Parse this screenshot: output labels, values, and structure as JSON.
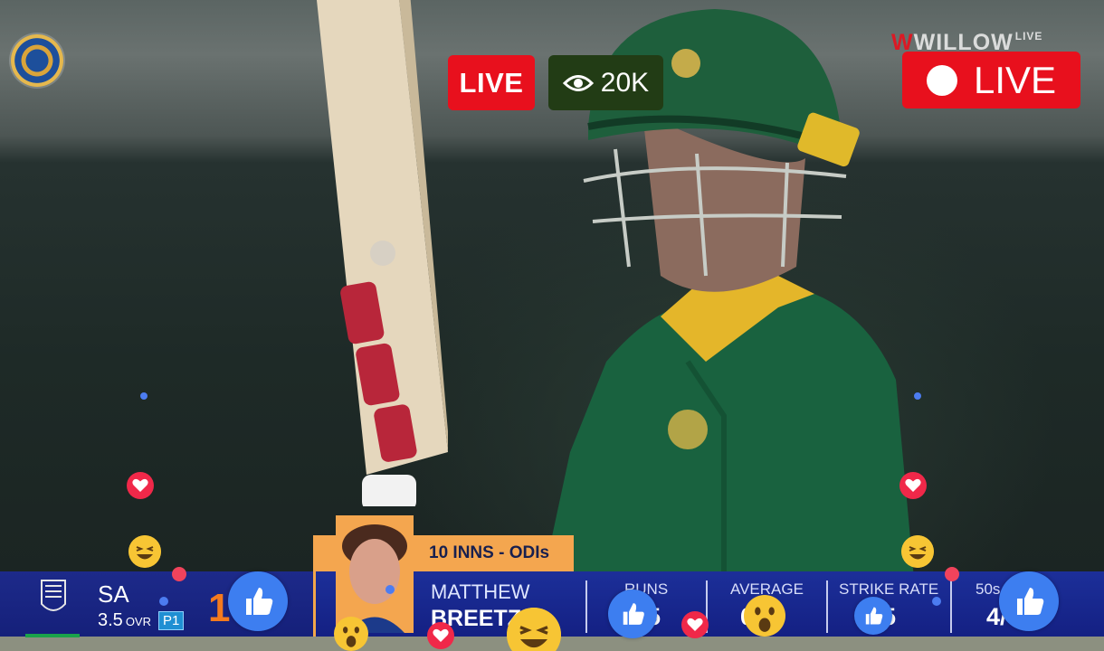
{
  "stream": {
    "live_badge": "LIVE",
    "viewer_count": "20K",
    "broadcaster_brand": "WILLOW",
    "broadcaster_brand_suffix": "LIVE",
    "live_indicator": "LIVE"
  },
  "scoreboard": {
    "team": "SA",
    "overs": "3.5",
    "overs_unit": "OVR",
    "powerplay": "P1",
    "score": "1",
    "innings_tab": "10 INNS - ODIs",
    "player_first": "MATTHEW",
    "player_last": "BREETZ",
    "stats": [
      {
        "label": "RUNS",
        "value": "5"
      },
      {
        "label": "AVERAGE",
        "value": "6 1"
      },
      {
        "label": "STRIKE RATE",
        "value": "5"
      },
      {
        "label": "50s",
        "value": "4/"
      }
    ]
  },
  "colors": {
    "live_red": "#e8101d",
    "scoreboard_blue": "#1c2f99",
    "accent_orange": "#f4a64f",
    "score_orange": "#f47a1e",
    "viewer_green": "#223c15",
    "like_blue": "#3d7ef0",
    "heart_red": "#f02849"
  },
  "reactions": [
    {
      "icon": "like-icon"
    },
    {
      "icon": "heart-icon"
    },
    {
      "icon": "laugh-icon"
    },
    {
      "icon": "wow-icon"
    }
  ]
}
